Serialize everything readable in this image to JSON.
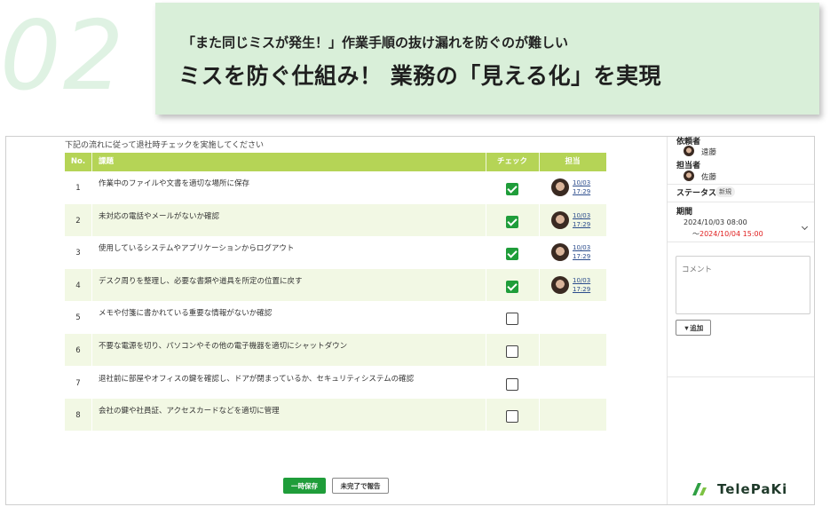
{
  "hero": {
    "number": "02",
    "subtitle": "「また同じミスが発生！」作業手順の抜け漏れを防ぐのが難しい",
    "title": "ミスを防ぐ仕組み！ 業務の「見える化」を実現"
  },
  "checklist": {
    "instruction": "下記の流れに従って退社時チェックを実施してください",
    "headers": {
      "no": "No.",
      "task": "課題",
      "check": "チェック",
      "person": "担当"
    },
    "rows": [
      {
        "no": "1",
        "task": "作業中のファイルや文書を適切な場所に保存",
        "checked": true,
        "date": "10/03",
        "time": "17:29"
      },
      {
        "no": "2",
        "task": "未対応の電話やメールがないか確認",
        "checked": true,
        "date": "10/03",
        "time": "17:29"
      },
      {
        "no": "3",
        "task": "使用しているシステムやアプリケーションからログアウト",
        "checked": true,
        "date": "10/03",
        "time": "17:29"
      },
      {
        "no": "4",
        "task": "デスク周りを整理し、必要な書類や道具を所定の位置に戻す",
        "checked": true,
        "date": "10/03",
        "time": "17:29"
      },
      {
        "no": "5",
        "task": "メモや付箋に書かれている重要な情報がないか確認",
        "checked": false,
        "date": "",
        "time": ""
      },
      {
        "no": "6",
        "task": "不要な電源を切り、パソコンやその他の電子機器を適切にシャットダウン",
        "checked": false,
        "date": "",
        "time": ""
      },
      {
        "no": "7",
        "task": "退社前に部屋やオフィスの鍵を確認し、ドアが閉まっているか、セキュリティシステムの確認",
        "checked": false,
        "date": "",
        "time": ""
      },
      {
        "no": "8",
        "task": "会社の鍵や社員証、アクセスカードなどを適切に管理",
        "checked": false,
        "date": "",
        "time": ""
      }
    ],
    "save_label": "一時保存",
    "report_label": "未完了で報告"
  },
  "side": {
    "requester_label": "依頼者",
    "requester_name": "遠藤",
    "assignee_label": "担当者",
    "assignee_name": "佐藤",
    "status_label": "ステータス",
    "status_value": "新規",
    "period_label": "期間",
    "period_start": "2024/10/03 08:00",
    "period_prefix": "〜",
    "period_end": "2024/10/04 15:00",
    "comment_placeholder": "コメント",
    "add_label": "▼追加"
  },
  "brand": {
    "name": "TelePaKi"
  },
  "colors": {
    "header": "#b5d456",
    "check": "#1f9d3a",
    "alt_row": "#f2f8e4",
    "banner": "#d9efd9",
    "deadline": "#e02020"
  }
}
